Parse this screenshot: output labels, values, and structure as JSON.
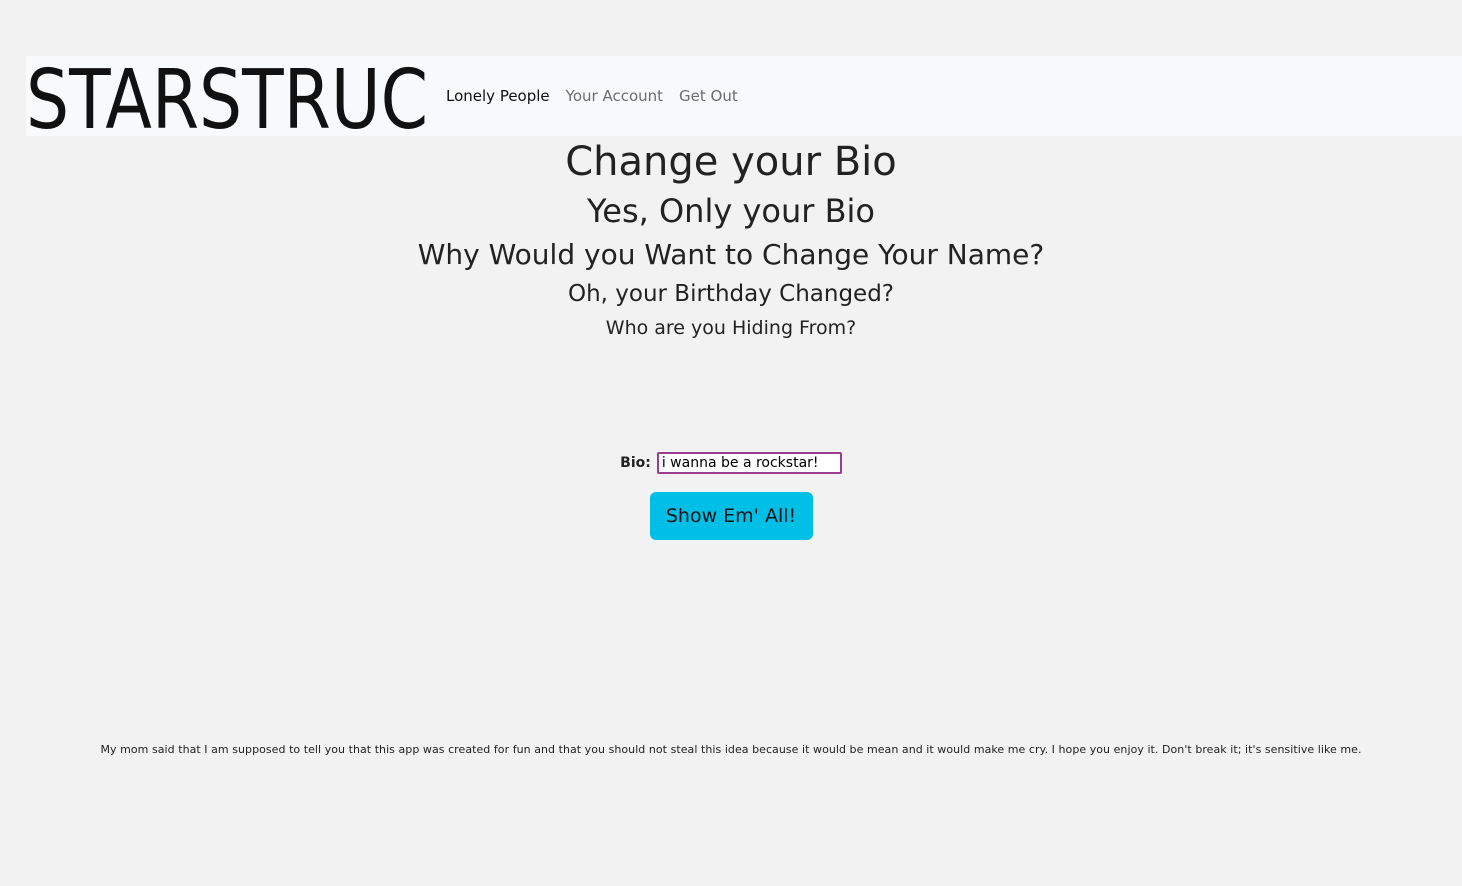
{
  "brand": {
    "logo_text": "STARSTRUC"
  },
  "nav": {
    "links": [
      {
        "label": "Lonely People",
        "active": true
      },
      {
        "label": "Your Account",
        "active": false
      },
      {
        "label": "Get Out",
        "active": false
      }
    ]
  },
  "headings": {
    "h1": "Change your Bio",
    "h2": "Yes, Only your Bio",
    "h3": "Why Would you Want to Change Your Name?",
    "h4": "Oh, your Birthday Changed?",
    "h5": "Who are you Hiding From?"
  },
  "form": {
    "bio_label": "Bio:",
    "bio_value": "i wanna be a rockstar!",
    "submit_label": "Show Em' All!"
  },
  "footer": {
    "text": "My mom said that I am supposed to tell you that this app was created for fun and that you should not steal this idea because it would be mean and it would make me cry. I hope you enjoy it. Don't break it; it's sensitive like me."
  },
  "colors": {
    "button": "#00bfe6",
    "input_border": "#9b3d8f",
    "navbar_bg": "#f8f9fa",
    "page_bg": "#f2f2f2"
  }
}
